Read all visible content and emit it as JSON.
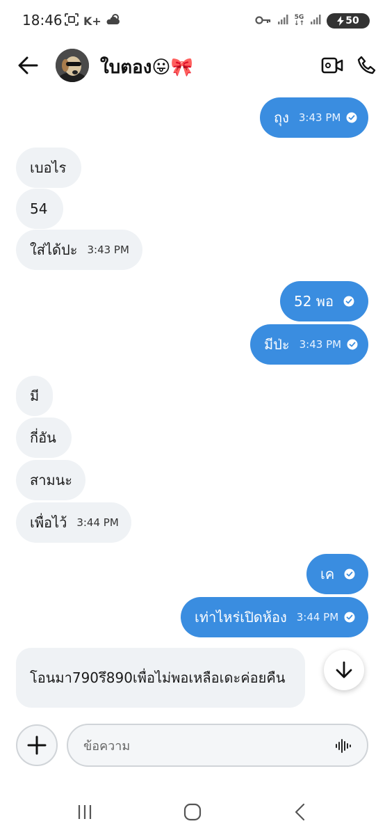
{
  "status_bar": {
    "time": "18:46",
    "carrier_badge": "K+",
    "network": "5G",
    "battery_level": "50"
  },
  "header": {
    "contact_name": "ใบตอง😛🎀",
    "icons": [
      "back-arrow-icon",
      "video-call-icon",
      "phone-icon"
    ]
  },
  "messages": [
    {
      "dir": "out",
      "text": "ถุง",
      "time": "3:43 PM",
      "read": true
    },
    {
      "dir": "in",
      "text": "เบอไร",
      "time": ""
    },
    {
      "dir": "in",
      "text": "54",
      "time": ""
    },
    {
      "dir": "in",
      "text": "ใส่ได้ปะ",
      "time": "3:43 PM"
    },
    {
      "dir": "out",
      "text": "52 พอ",
      "time": "",
      "read": true
    },
    {
      "dir": "out",
      "text": "มีป่ะ",
      "time": "3:43 PM",
      "read": true
    },
    {
      "dir": "in",
      "text": "มี",
      "time": ""
    },
    {
      "dir": "in",
      "text": "กี่อัน",
      "time": ""
    },
    {
      "dir": "in",
      "text": "สามนะ",
      "time": ""
    },
    {
      "dir": "in",
      "text": "เพื่อไว้",
      "time": "3:44 PM"
    },
    {
      "dir": "out",
      "text": "เค",
      "time": "",
      "read": true
    },
    {
      "dir": "out",
      "text": "เท่าไหร่เปิดห้อง",
      "time": "3:44 PM",
      "read": true
    },
    {
      "dir": "in",
      "text": "โอนมา790รึ890เพื่อไม่พอเหลือเดะค่อยคืน",
      "time": ""
    }
  ],
  "composer": {
    "placeholder": "ข้อความ"
  },
  "colors": {
    "outgoing_bubble": "#3a8de0",
    "incoming_bubble": "#eff2f5",
    "background": "#ffffff"
  }
}
